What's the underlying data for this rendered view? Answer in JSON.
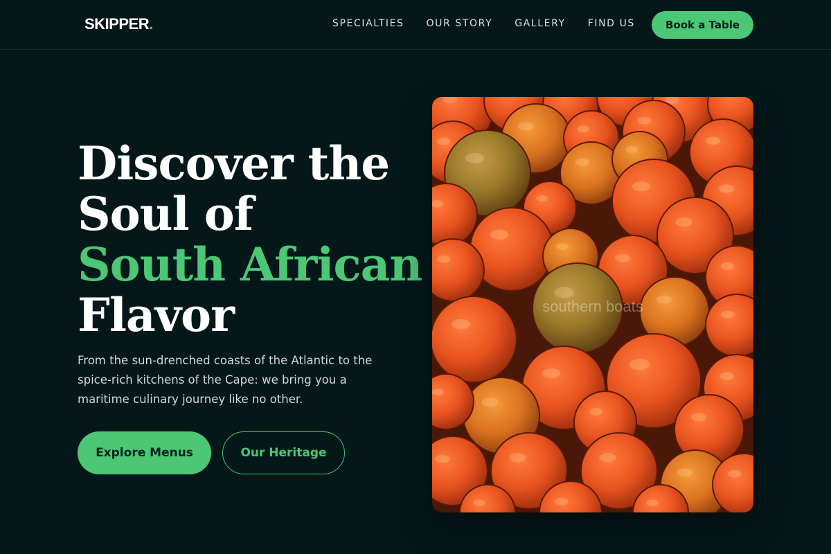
{
  "nav": {
    "logo_text": "SKIPPER",
    "logo_dot": ".",
    "links": [
      {
        "label": "SPECIALTIES"
      },
      {
        "label": "OUR STORY"
      },
      {
        "label": "GALLERY"
      },
      {
        "label": "FIND US"
      }
    ],
    "cta_label": "Book a Table"
  },
  "hero": {
    "title_line1": "Discover the",
    "title_line2": "Soul of",
    "title_accent": "South African",
    "title_line4": "Flavor",
    "description": "From the sun-drenched coasts of the Atlantic to the spice-rich kitchens of the Cape: we bring you a maritime culinary journey like no other.",
    "primary_button": "Explore Menus",
    "secondary_button": "Our Heritage"
  },
  "image": {
    "icon": "oranges-photo",
    "watermark": "southern boats"
  },
  "colors": {
    "background": "#04181a",
    "accent": "#4cc776",
    "text": "#ffffff"
  }
}
